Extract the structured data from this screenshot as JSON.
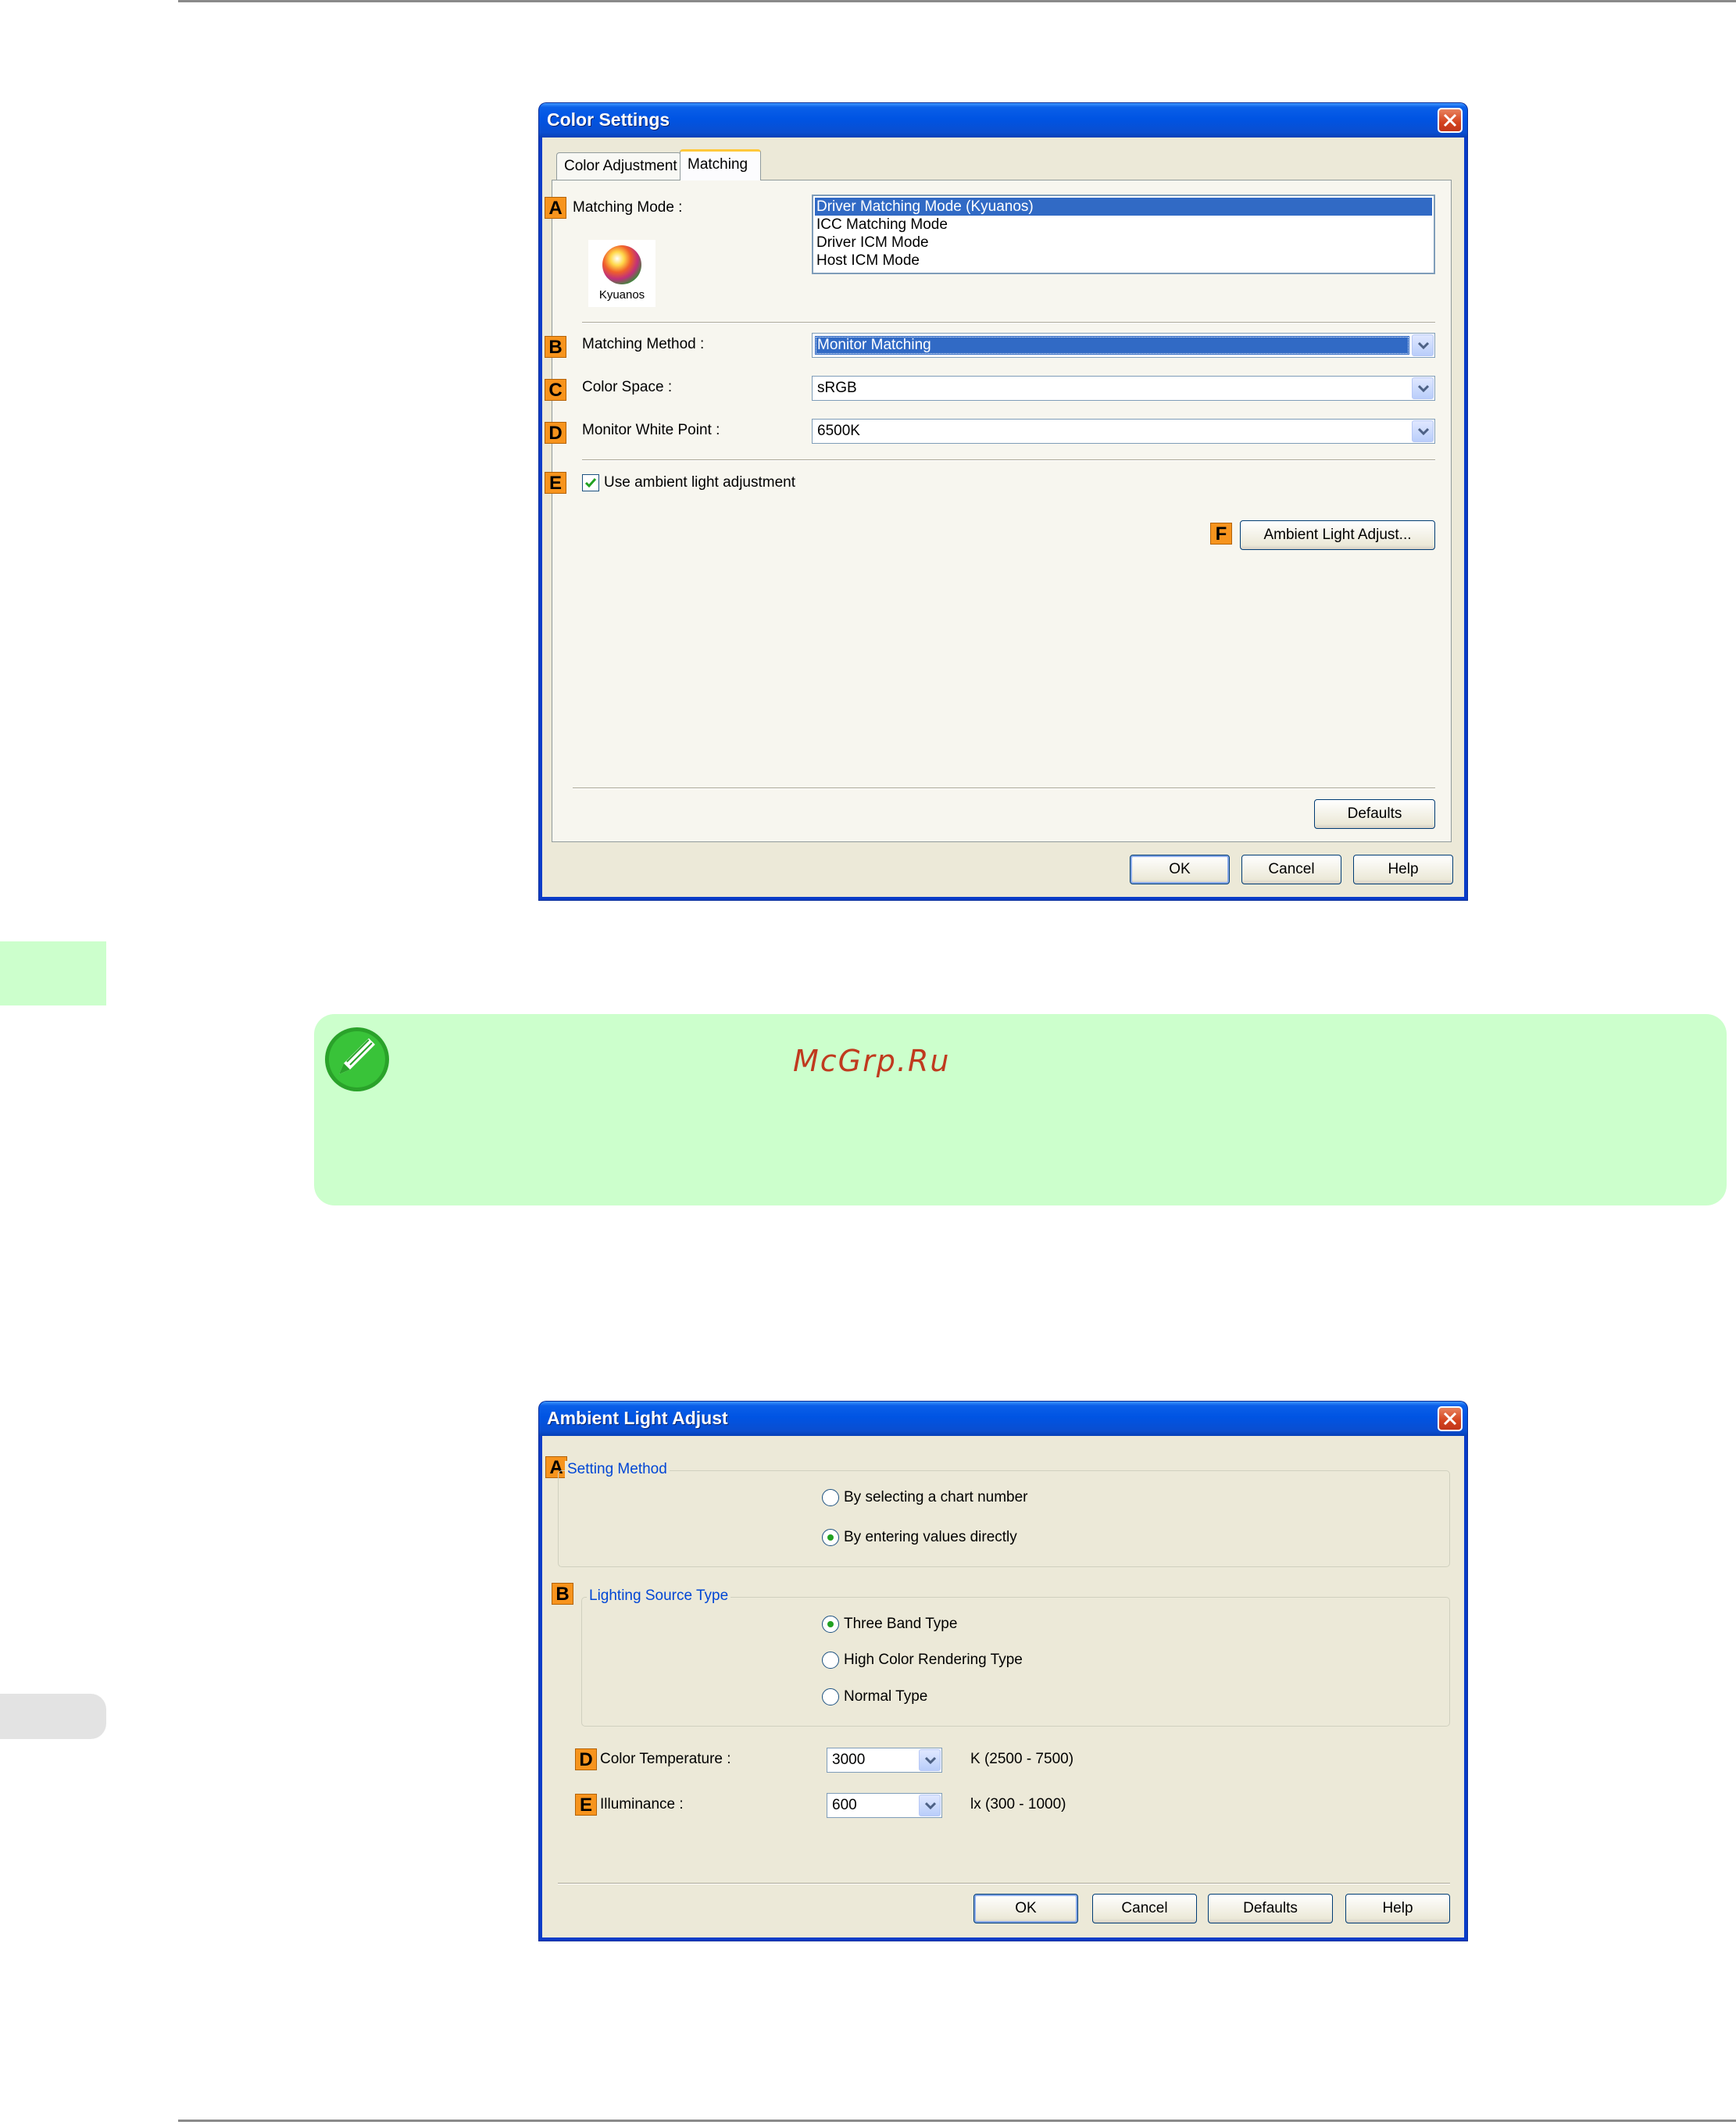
{
  "watermark": "McGrp.Ru",
  "color_settings": {
    "title": "Color Settings",
    "tabs": [
      "Color Adjustment",
      "Matching"
    ],
    "active_tab": "Matching",
    "badges": [
      "A",
      "B",
      "C",
      "D",
      "E",
      "F"
    ],
    "matching_mode_label": "Matching Mode :",
    "matching_mode_options": [
      "Driver Matching Mode (Kyuanos)",
      "ICC Matching Mode",
      "Driver ICM Mode",
      "Host ICM Mode"
    ],
    "matching_mode_selected": "Driver Matching Mode (Kyuanos)",
    "logo_text": "Kyuanos",
    "matching_method_label": "Matching Method :",
    "matching_method_value": "Monitor Matching",
    "color_space_label": "Color Space :",
    "color_space_value": "sRGB",
    "white_point_label": "Monitor White Point :",
    "white_point_value": "6500K",
    "ambient_checkbox_label": "Use ambient light adjustment",
    "ambient_checkbox_checked": true,
    "ambient_button": "Ambient Light Adjust...",
    "defaults_button": "Defaults",
    "ok_button": "OK",
    "cancel_button": "Cancel",
    "help_button": "Help"
  },
  "ambient_light": {
    "title": "Ambient Light Adjust",
    "badges": [
      "A",
      "B",
      "D",
      "E"
    ],
    "setting_method_title": "Setting Method",
    "setting_method_options": [
      "By selecting a chart number",
      "By entering values directly"
    ],
    "setting_method_selected": "By entering values directly",
    "lighting_source_title": "Lighting Source Type",
    "lighting_source_options": [
      "Three Band Type",
      "High Color Rendering Type",
      "Normal Type"
    ],
    "lighting_source_selected": "Three Band Type",
    "color_temp_label": "Color Temperature :",
    "color_temp_value": "3000",
    "color_temp_range": "K (2500 - 7500)",
    "illuminance_label": "Illuminance :",
    "illuminance_value": "600",
    "illuminance_range": "lx (300 - 1000)",
    "ok_button": "OK",
    "cancel_button": "Cancel",
    "defaults_button": "Defaults",
    "help_button": "Help"
  },
  "colors": {
    "note_background": "#ccffcc",
    "badge": "#f7941d",
    "xp_title_blue": "#0054e3",
    "selection_blue": "#316ac5",
    "watermark_red": "#c03a1e"
  }
}
